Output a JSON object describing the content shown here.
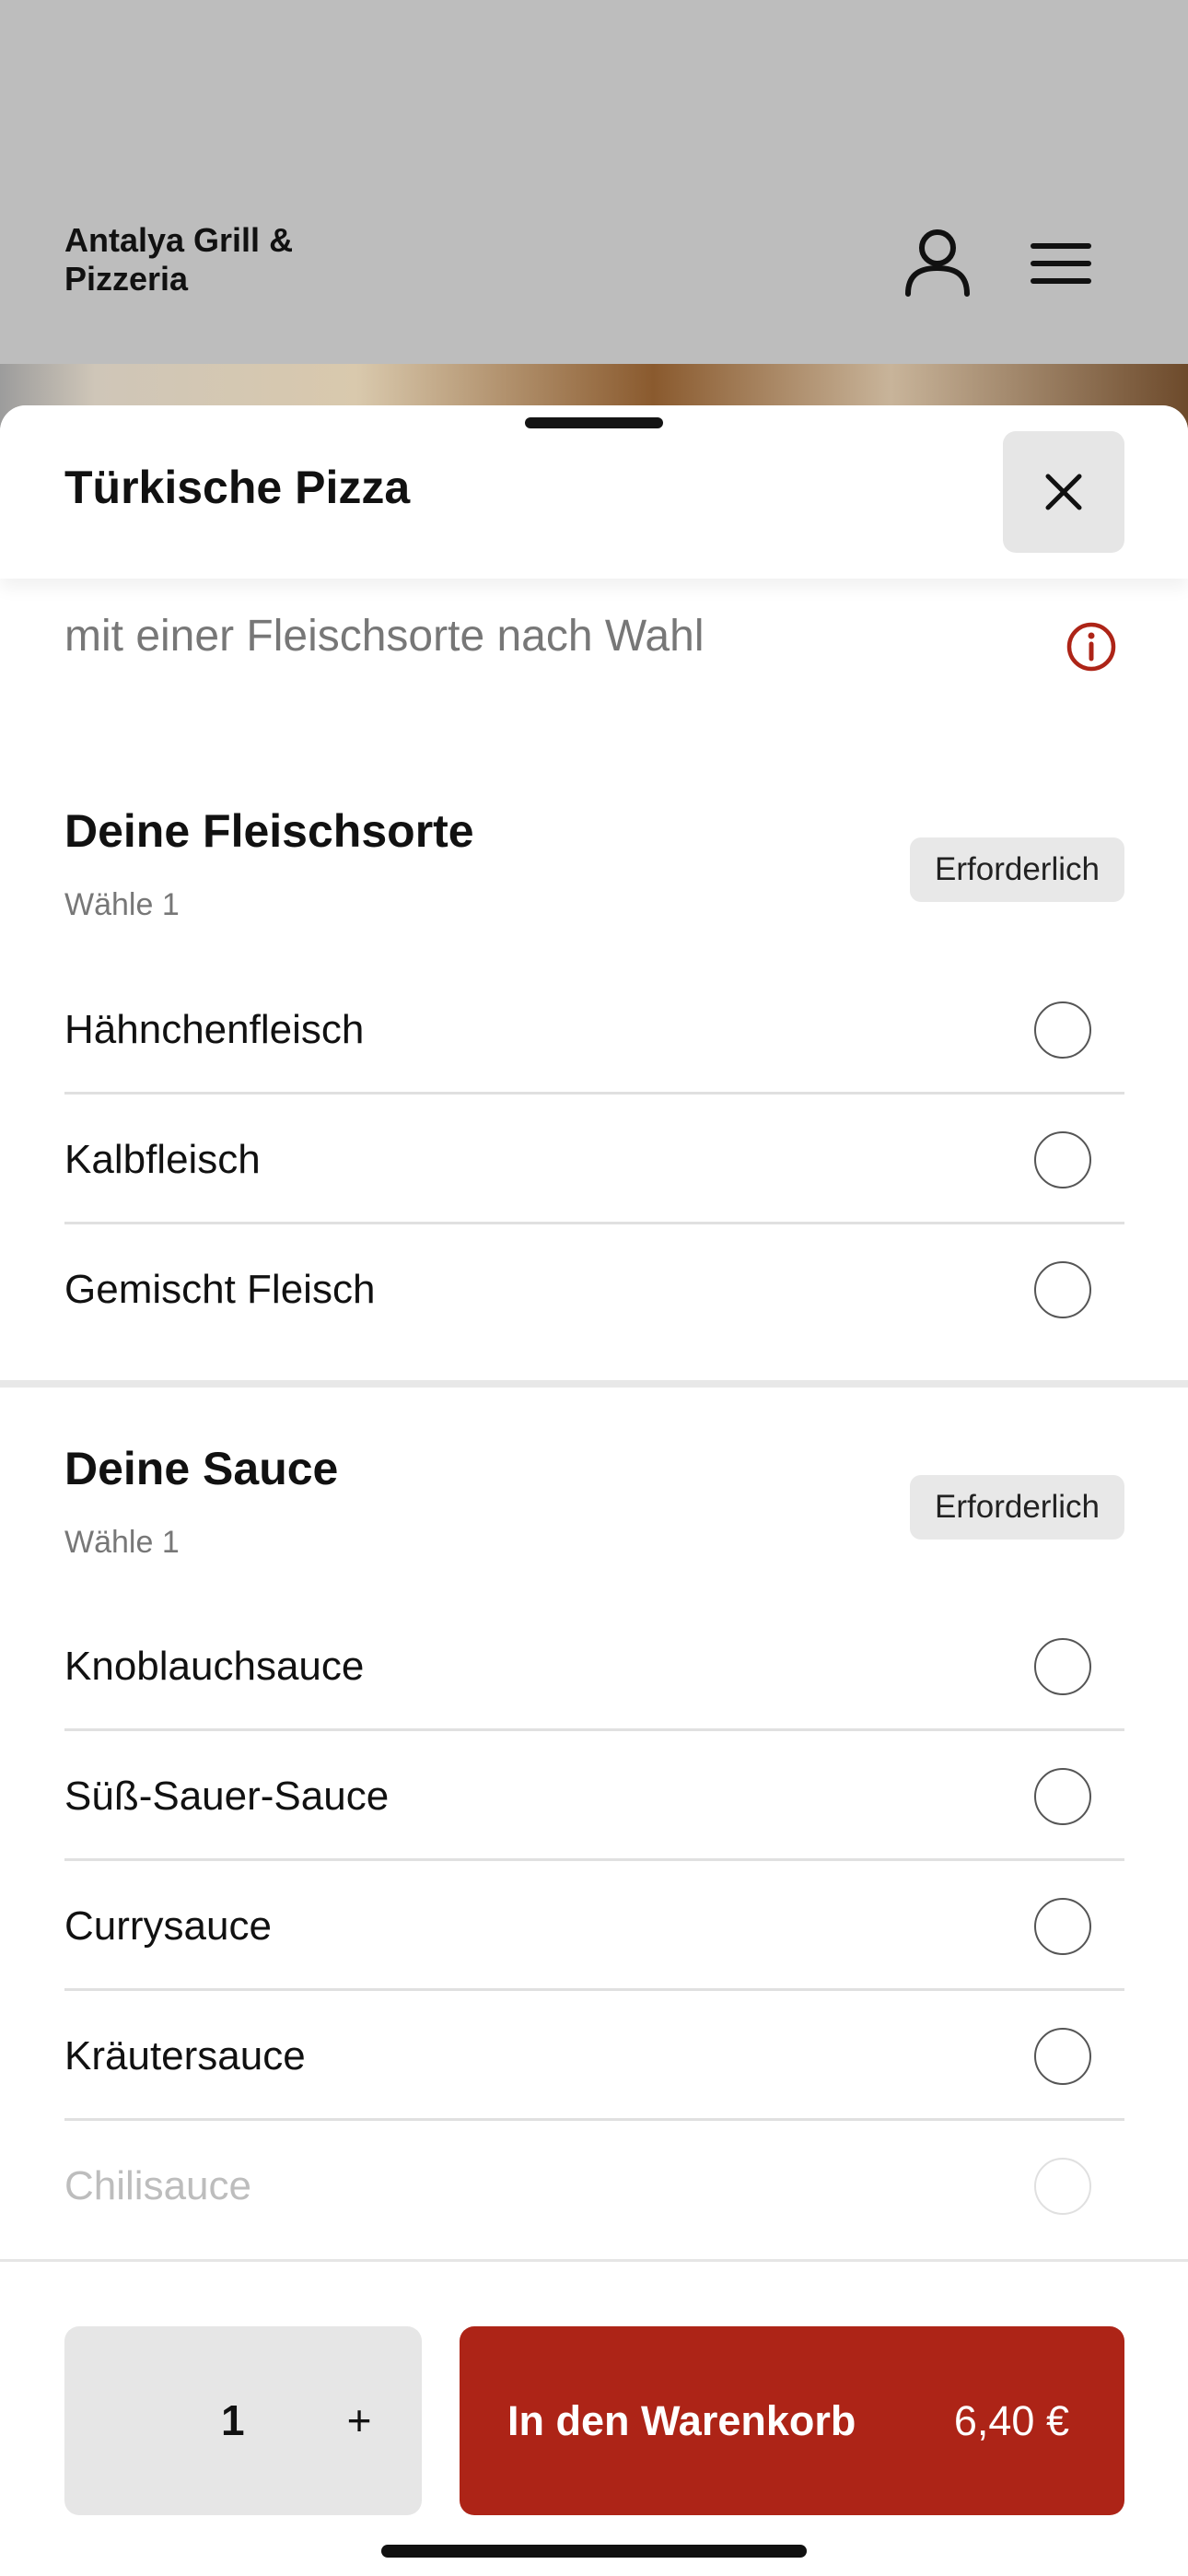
{
  "header": {
    "restaurant_name": "Antalya Grill & Pizzeria",
    "icons": [
      "user-icon",
      "menu-icon"
    ]
  },
  "sheet": {
    "title": "Türkische Pizza",
    "description": "mit einer Fleischsorte nach Wahl",
    "close_icon": "close-icon",
    "info_icon": "info-icon",
    "accent_color": "#ad2417"
  },
  "groups": [
    {
      "title": "Deine Fleischsorte",
      "subtitle": "Wähle 1",
      "badge": "Erforderlich",
      "options": [
        "Hähnchenfleisch",
        "Kalbfleisch",
        "Gemischt Fleisch"
      ]
    },
    {
      "title": "Deine Sauce",
      "subtitle": "Wähle 1",
      "badge": "Erforderlich",
      "options": [
        "Knoblauchsauce",
        "Süß-Sauer-Sauce",
        "Currysauce",
        "Kräutersauce",
        "Chilisauce"
      ]
    }
  ],
  "footer": {
    "quantity": "1",
    "plus": "+",
    "add_to_cart": "In den Warenkorb",
    "price": "6,40 €"
  }
}
